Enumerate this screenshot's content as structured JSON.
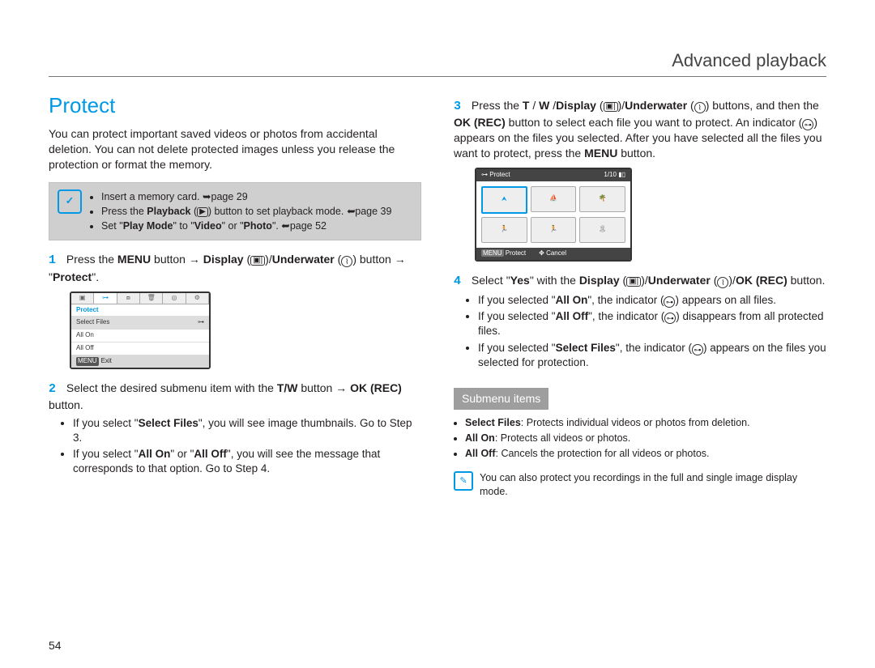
{
  "header": {
    "title": "Advanced playback"
  },
  "section": {
    "heading": "Protect"
  },
  "intro": "You can protect important saved videos or photos from accidental deletion. You can not delete protected images unless you release the protection or format the memory.",
  "prereq": {
    "items": [
      "Insert a memory card. ➥page 29",
      "Press the Playback (▣) button to set playback mode. ➥page 39",
      "Set \"Play Mode\" to \"Video\" or \"Photo\". ➥page 52"
    ]
  },
  "step1": {
    "num": "1",
    "a": "Press the ",
    "menu": "MENU",
    "b": " button → ",
    "disp": "Display",
    "c": " (",
    "d": ")/",
    "under": "Underwater",
    "e": " (",
    "f": ") button → \"",
    "protect": "Protect",
    "g": "\"."
  },
  "fig1": {
    "title": "Protect",
    "items": [
      "Select Files",
      "All On",
      "All Off"
    ],
    "exit": "Exit"
  },
  "step2": {
    "num": "2",
    "a": "Select the desired submenu item with the ",
    "tw": "T/W",
    "b": " button → ",
    "ok": "OK (REC)",
    "c": " button.",
    "bul1a": "If you select \"",
    "sf": "Select Files",
    "bul1b": "\", you will see image thumbnails. Go to Step 3.",
    "bul2a": "If you select \"",
    "aon": "All On",
    "bul2b": "\" or \"",
    "aoff": "All Off",
    "bul2c": "\", you will see the message that corresponds to that option. Go to Step 4."
  },
  "step3": {
    "num": "3",
    "a": "Press the ",
    "tw": "T",
    "slash1": " / ",
    "w": "W",
    "slash2": " /",
    "disp": "Display",
    "b": " (",
    "c": ")/",
    "under": "Underwater",
    "d": " (",
    "e": ") buttons, and then the ",
    "ok": "OK (REC)",
    "f": " button to select each file you want to protect. An indicator (",
    "g": ") appears on the files you selected. After you have selected all the files you want to protect, press the ",
    "menu": "MENU",
    "h": " button."
  },
  "fig2": {
    "title": "Protect",
    "counter": "1/10",
    "protect": "Protect",
    "cancel": "Cancel"
  },
  "step4": {
    "num": "4",
    "a": "Select \"",
    "yes": "Yes",
    "b": "\" with the ",
    "disp": "Display",
    "c": " (",
    "d": ")/",
    "under": "Underwater",
    "e": " (",
    "f": ")/",
    "ok": "OK (REC)",
    "g": " button.",
    "bul1a": "If you selected \"",
    "aon": "All On",
    "bul1b": "\", the indicator (",
    "bul1c": ") appears on all files.",
    "bul2a": "If you selected \"",
    "aoff": "All Off",
    "bul2b": "\", the indicator (",
    "bul2c": ") disappears from all protected files.",
    "bul3a": "If you selected \"",
    "sf": "Select Files",
    "bul3b": "\", the indicator (",
    "bul3c": ") appears on the files you selected for protection."
  },
  "submenu": {
    "title": "Submenu items",
    "items": [
      {
        "label": "Select Files",
        "desc": ": Protects individual videos or photos from deletion."
      },
      {
        "label": "All On",
        "desc": ": Protects all videos or photos."
      },
      {
        "label": "All Off",
        "desc": ": Cancels the protection for all videos or photos."
      }
    ]
  },
  "note": "You can also protect you recordings in the full and single image display mode.",
  "page_number": "54",
  "icons": {
    "display": "▣|",
    "underwater": "⌇",
    "key": "⊶",
    "check": "✓",
    "pencil": "✎",
    "menu_tag": "MENU",
    "batt": "▮▯"
  }
}
